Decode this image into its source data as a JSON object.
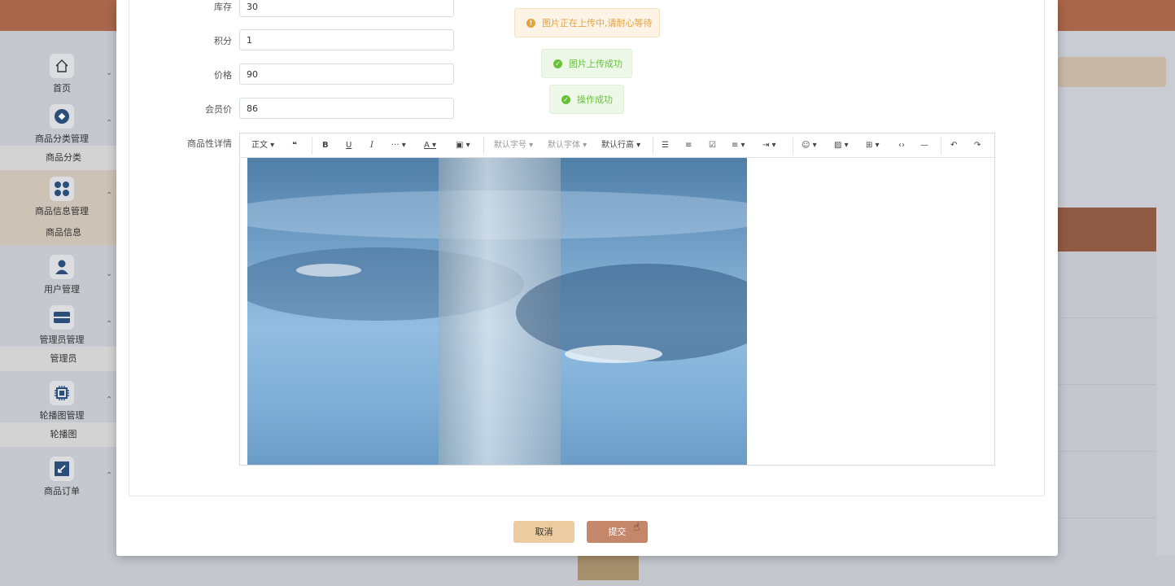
{
  "sidebar": {
    "items": [
      {
        "label": "首页",
        "icon": "home-icon"
      },
      {
        "label": "商品分类管理",
        "icon": "category-icon",
        "sub": "商品分类"
      },
      {
        "label": "商品信息管理",
        "icon": "grid-icon",
        "sub": "商品信息"
      },
      {
        "label": "用户管理",
        "icon": "user-icon"
      },
      {
        "label": "管理员管理",
        "icon": "admin-icon",
        "sub": "管理员"
      },
      {
        "label": "轮播图管理",
        "icon": "chip-icon",
        "sub": "轮播图"
      },
      {
        "label": "商品订单",
        "icon": "order-icon"
      }
    ]
  },
  "form": {
    "stock": {
      "label": "库存",
      "value": "30"
    },
    "points": {
      "label": "积分",
      "value": "1"
    },
    "price": {
      "label": "价格",
      "value": "90"
    },
    "member_price": {
      "label": "会员价",
      "value": "86"
    },
    "detail": {
      "label": "商品性详情"
    }
  },
  "editor": {
    "toolbar": {
      "paragraph": "正文",
      "font_size": "默认字号",
      "font_family": "默认字体",
      "line_height": "默认行高"
    }
  },
  "toasts": {
    "uploading": "图片正在上传中,请耐心等待",
    "upload_success": "图片上传成功",
    "op_success": "操作成功"
  },
  "footer": {
    "cancel": "取消",
    "submit": "提交"
  },
  "colors": {
    "topbar": "#a9664a",
    "submit": "#c4876a",
    "cancel": "#ebcb9f",
    "success": "#67c23a",
    "warning": "#e6a23c"
  }
}
